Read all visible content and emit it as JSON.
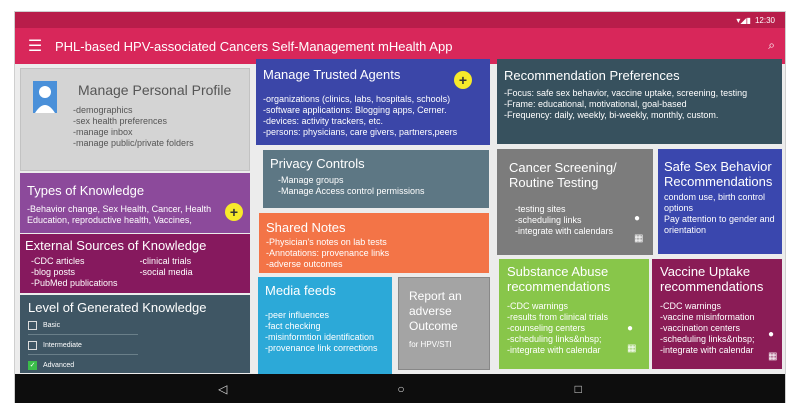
{
  "status": {
    "time": "12:30",
    "icons": "▾◢▮"
  },
  "app": {
    "title": "PHL-based HPV-associated Cancers Self-Management mHealth App",
    "menu_icon": "☰",
    "search_icon": "⌕"
  },
  "profile": {
    "title": "Manage Personal Profile",
    "items": [
      "-demographics",
      "-sex health preferences",
      "-manage inbox",
      "-manage public/private folders"
    ]
  },
  "agents": {
    "title": "Manage Trusted Agents",
    "plus": "+",
    "items": [
      "-organizations (clinics, labs, hospitals, schools)",
      "-software applications: Blogging apps, Cerner.",
      "-devices: activity trackers, etc.",
      "-persons: physicians, care givers, partners,peers"
    ]
  },
  "recpref": {
    "title": "Recommendation Preferences",
    "items": [
      "-Focus: safe sex behavior, vaccine uptake, screening, testing",
      "-Frame: educational, motivational, goal-based",
      "-Frequency: daily, weekly, bi-weekly, monthly, custom."
    ]
  },
  "knowledge": {
    "title": "Types of Knowledge",
    "plus": "+",
    "items": [
      "-Behavior change, Sex Health, Cancer, Health",
      "Education, reproductive health, Vaccines,"
    ]
  },
  "privacy": {
    "title": "Privacy Controls",
    "items": [
      "-Manage groups",
      "-Manage Access control permissions"
    ]
  },
  "screening": {
    "title": "Cancer Screening/ Routine Testing",
    "items": [
      "-testing sites",
      "-scheduling links",
      "-integrate with calendars"
    ]
  },
  "safesex": {
    "title": "Safe Sex Behavior Recommendations",
    "items": [
      "condom use, birth control options",
      "Pay attention to gender and orientation"
    ]
  },
  "external": {
    "title": "External Sources of Knowledge",
    "col1": [
      "-CDC articles",
      "-blog posts",
      "-PubMed publications"
    ],
    "col2": [
      "-clinical trials",
      "-social media"
    ]
  },
  "notes": {
    "title": "Shared Notes",
    "items": [
      "-Physician's notes on lab tests",
      "-Annotations: provenance links",
      "-adverse outcomes"
    ]
  },
  "generated": {
    "title": "Level of Generated Knowledge",
    "options": [
      {
        "label": "Basic",
        "checked": false
      },
      {
        "label": "Intermediate",
        "checked": false
      },
      {
        "label": "Advanced",
        "checked": true
      }
    ]
  },
  "media": {
    "title": "Media feeds",
    "items": [
      "-peer influences",
      "-fact checking",
      "-misinformtion identification",
      "-provenance link corrections"
    ]
  },
  "adverse": {
    "title": "Report an adverse Outcome",
    "subtitle": "for HPV/STI"
  },
  "substance": {
    "title": "Substance Abuse recommendations",
    "items": [
      "-CDC warnings",
      "-results from clinical trials",
      "-counseling centers",
      "-scheduling links&nbsp;",
      "-integrate with calendar"
    ]
  },
  "vaccine": {
    "title": "Vaccine Uptake recommendations",
    "items": [
      "-CDC warnings",
      "-vaccine misinformation",
      "-vaccination centers",
      "-scheduling links&nbsp;",
      "-integrate with calendar"
    ]
  },
  "nav": {
    "back": "◁",
    "home": "○",
    "recent": "□"
  },
  "colors": {
    "statusbar": "#b81d4a",
    "appbar": "#d8275a",
    "profile": "#d4d4d4",
    "agents": "#3b46a8",
    "recpref": "#37515e",
    "knowledge": "#8c4a9b",
    "privacy": "#5d7784",
    "screening": "#7c7c7c",
    "safesex": "#3a47ae",
    "external": "#86195e",
    "notes": "#f37447",
    "generated": "#3f5664",
    "media": "#2ca9d8",
    "adverse": "#a4a4a4",
    "substance": "#88c64a",
    "vaccine": "#8a1c56"
  }
}
